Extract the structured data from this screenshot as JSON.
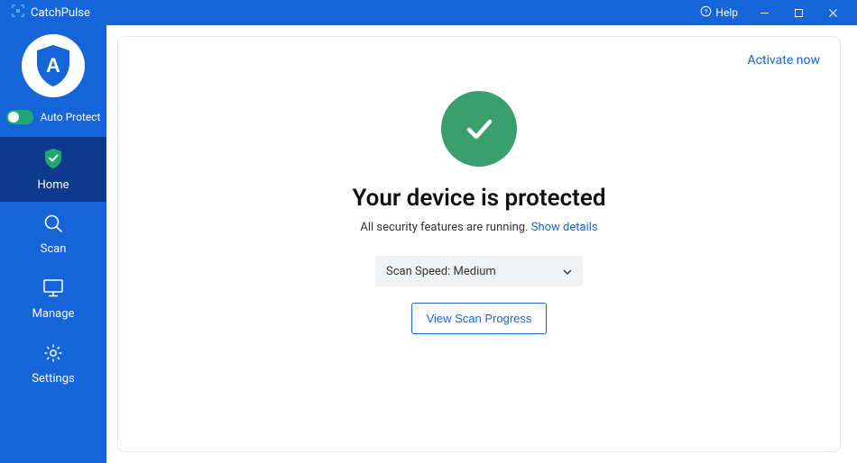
{
  "app": {
    "title": "CatchPulse",
    "help_label": "Help"
  },
  "sidebar": {
    "auto_protect_label": "Auto Protect",
    "auto_protect_on": true,
    "items": [
      {
        "id": "home",
        "label": "Home",
        "active": true
      },
      {
        "id": "scan",
        "label": "Scan",
        "active": false
      },
      {
        "id": "manage",
        "label": "Manage",
        "active": false
      },
      {
        "id": "settings",
        "label": "Settings",
        "active": false
      }
    ]
  },
  "main": {
    "activate_label": "Activate now",
    "status_title": "Your device is protected",
    "status_subtitle": "All security features are running. ",
    "status_details_link": "Show details",
    "scan_speed_label": "Scan Speed: Medium",
    "view_progress_label": "View Scan Progress"
  }
}
